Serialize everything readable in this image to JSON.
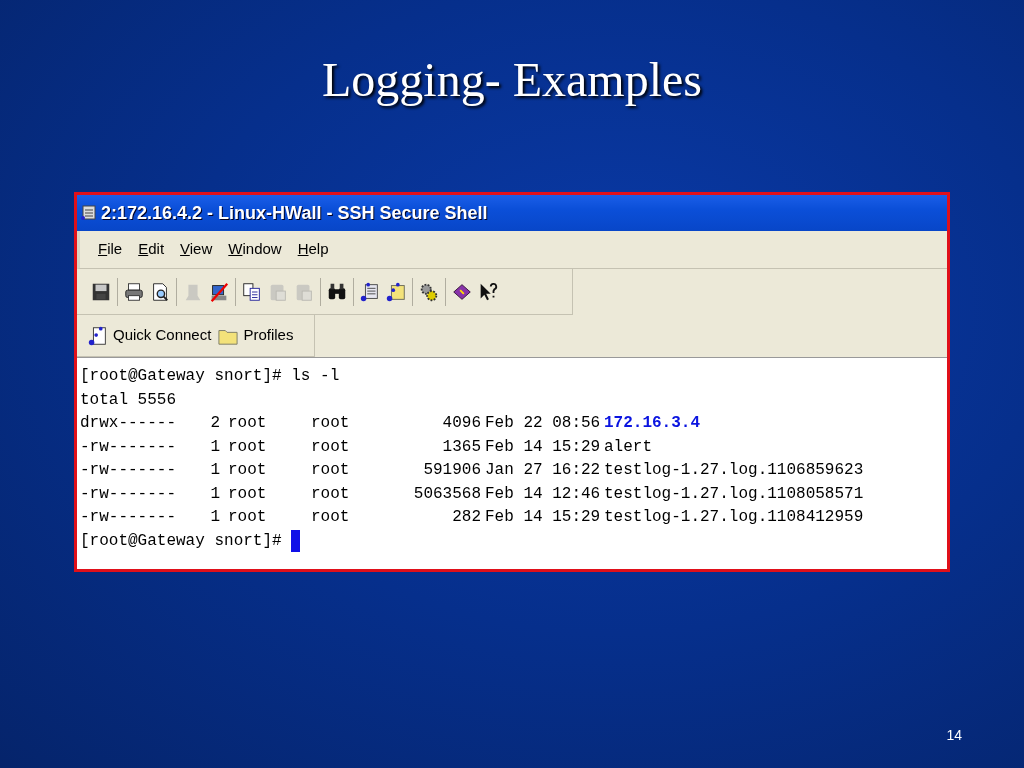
{
  "slide": {
    "title": "Logging- Examples",
    "page_number": "14"
  },
  "window": {
    "title": "2:172.16.4.2 - Linux-HWall - SSH Secure Shell",
    "menu": [
      "File",
      "Edit",
      "View",
      "Window",
      "Help"
    ],
    "toolbar": [
      [
        {
          "kind": "save",
          "disabled": false
        }
      ],
      [
        {
          "kind": "print",
          "disabled": false
        },
        {
          "kind": "preview",
          "disabled": false
        }
      ],
      [
        {
          "kind": "connect",
          "disabled": true
        },
        {
          "kind": "disconnect",
          "disabled": false
        }
      ],
      [
        {
          "kind": "copy",
          "disabled": false
        },
        {
          "kind": "paste",
          "disabled": true
        },
        {
          "kind": "paste",
          "disabled": true
        }
      ],
      [
        {
          "kind": "find",
          "disabled": false
        }
      ],
      [
        {
          "kind": "terminal",
          "disabled": false
        },
        {
          "kind": "transfer",
          "disabled": false
        }
      ],
      [
        {
          "kind": "settings",
          "disabled": false
        }
      ],
      [
        {
          "kind": "book",
          "disabled": false
        },
        {
          "kind": "whatsthis",
          "disabled": false
        }
      ]
    ],
    "shortcuts": [
      {
        "kind": "quick",
        "label": "Quick Connect"
      },
      {
        "kind": "folder",
        "label": "Profiles"
      }
    ]
  },
  "terminal": {
    "command_prompt": "[root@Gateway snort]# ls -l",
    "total": "total 5556",
    "rows": [
      {
        "perms": "drwx------",
        "links": "2",
        "owner": "root",
        "group": "root",
        "size": "4096",
        "date": "Feb 22 08:56",
        "name": "172.16.3.4",
        "kind": "dir"
      },
      {
        "perms": "-rw-------",
        "links": "1",
        "owner": "root",
        "group": "root",
        "size": "1365",
        "date": "Feb 14 15:29",
        "name": "alert",
        "kind": "file"
      },
      {
        "perms": "-rw-------",
        "links": "1",
        "owner": "root",
        "group": "root",
        "size": "591906",
        "date": "Jan 27 16:22",
        "name": "testlog-1.27.log.1106859623",
        "kind": "file"
      },
      {
        "perms": "-rw-------",
        "links": "1",
        "owner": "root",
        "group": "root",
        "size": "5063568",
        "date": "Feb 14 12:46",
        "name": "testlog-1.27.log.1108058571",
        "kind": "file"
      },
      {
        "perms": "-rw-------",
        "links": "1",
        "owner": "root",
        "group": "root",
        "size": "282",
        "date": "Feb 14 15:29",
        "name": "testlog-1.27.log.1108412959",
        "kind": "file"
      }
    ],
    "prompt": "[root@Gateway snort]#"
  }
}
